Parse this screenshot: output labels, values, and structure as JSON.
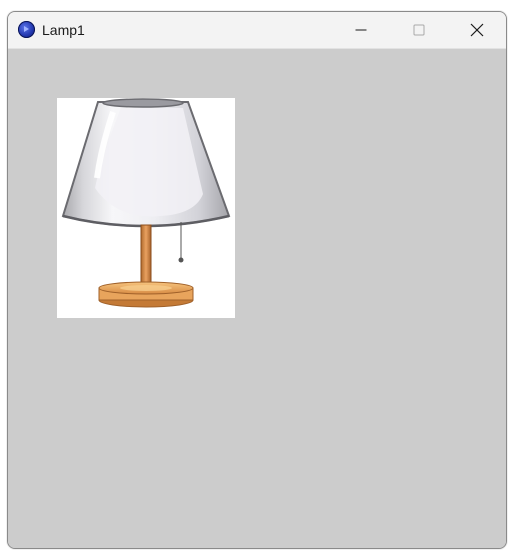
{
  "window": {
    "title": "Lamp1",
    "app_icon": "app-circle-icon"
  },
  "caption_buttons": {
    "minimize_icon": "minimize-icon",
    "maximize_icon": "maximize-icon",
    "close_icon": "close-icon"
  },
  "client": {
    "background_color": "#cccccc",
    "image": {
      "subject": "table-lamp-icon"
    }
  }
}
